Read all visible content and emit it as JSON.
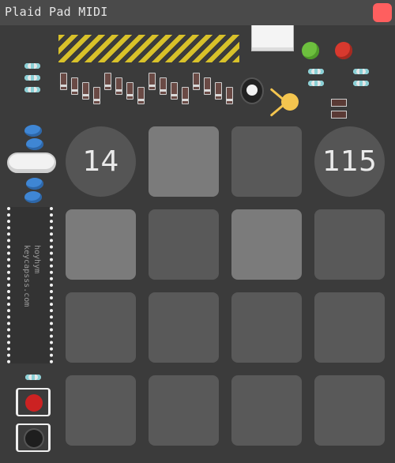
{
  "window": {
    "title": "Plaid Pad MIDI"
  },
  "chip": {
    "label_line1": "hoyhym",
    "label_line2": "keycapsss.com"
  },
  "knobs": {
    "left_value": "14",
    "right_value": "115"
  },
  "pads": [
    {
      "row": 1,
      "col": 2,
      "lit": true
    },
    {
      "row": 1,
      "col": 3,
      "lit": false
    },
    {
      "row": 2,
      "col": 1,
      "lit": true
    },
    {
      "row": 2,
      "col": 2,
      "lit": false
    },
    {
      "row": 2,
      "col": 3,
      "lit": true
    },
    {
      "row": 2,
      "col": 4,
      "lit": false
    },
    {
      "row": 3,
      "col": 1,
      "lit": false
    },
    {
      "row": 3,
      "col": 2,
      "lit": false
    },
    {
      "row": 3,
      "col": 3,
      "lit": false
    },
    {
      "row": 3,
      "col": 4,
      "lit": false
    },
    {
      "row": 4,
      "col": 1,
      "lit": false
    },
    {
      "row": 4,
      "col": 2,
      "lit": false
    },
    {
      "row": 4,
      "col": 3,
      "lit": false
    },
    {
      "row": 4,
      "col": 4,
      "lit": false
    }
  ],
  "colors": {
    "close": "#fe5f5f",
    "pad_dim": "#595959",
    "pad_lit": "#7b7b7b",
    "led_green": "#6dbf3e",
    "led_red": "#d8392e",
    "reset_button": "#cc2222",
    "user_button": "#1e1e1e"
  }
}
